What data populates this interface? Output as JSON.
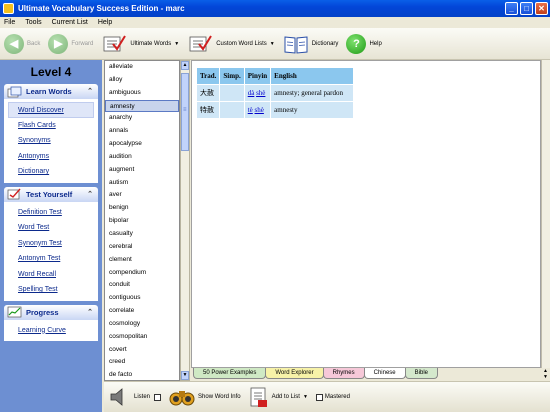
{
  "window": {
    "title": "Ultimate Vocabulary Success Edition - marc",
    "minimize": "_",
    "maximize": "□",
    "close": "✕"
  },
  "menu": [
    "File",
    "Tools",
    "Current List",
    "Help"
  ],
  "toolbar": {
    "back": "Back",
    "forward": "Forward",
    "ultimate_words": "Ultimate Words",
    "custom_word_lists": "Custom Word Lists",
    "dictionary": "Dictionary",
    "help": "Help",
    "help_glyph": "?"
  },
  "sidebar": {
    "level": "Level 4",
    "learn_words": {
      "title": "Learn Words",
      "items": [
        "Word Discover",
        "Flash Cards",
        "Synonyms",
        "Antonyms",
        "Dictionary"
      ]
    },
    "test_yourself": {
      "title": "Test Yourself",
      "items": [
        "Definition Test",
        "Word Test",
        "Synonym Test",
        "Antonym Test",
        "Word Recall",
        "Spelling Test"
      ]
    },
    "progress": {
      "title": "Progress",
      "items": [
        "Learning Curve"
      ]
    }
  },
  "word_list": [
    "alleviate",
    "alloy",
    "ambiguous",
    "amnesty",
    "anarchy",
    "annals",
    "apocalypse",
    "audition",
    "augment",
    "autism",
    "aver",
    "benign",
    "bipolar",
    "casualty",
    "cerebral",
    "clement",
    "compendium",
    "conduit",
    "contiguous",
    "correlate",
    "cosmology",
    "cosmopolitan",
    "covert",
    "creed",
    "de facto"
  ],
  "selected_word": "amnesty",
  "glossary": {
    "headers": [
      "Trad.",
      "Simp.",
      "Pinyin",
      "English"
    ],
    "rows": [
      {
        "trad": "大赦",
        "simp": "",
        "pinyin": [
          "dà",
          "shè"
        ],
        "english": "amnesty; general pardon"
      },
      {
        "trad": "特赦",
        "simp": "",
        "pinyin": [
          "tè",
          "shè"
        ],
        "english": "amnesty"
      }
    ]
  },
  "tabs": [
    {
      "label": "50 Power Examples",
      "color": "#cfe9c4"
    },
    {
      "label": "Word Explorer",
      "color": "#f7f2a8"
    },
    {
      "label": "Rhymes",
      "color": "#f6c8d8"
    },
    {
      "label": "Chinese",
      "color": "#ffffff"
    },
    {
      "label": "Bible",
      "color": "#d4e8cc"
    }
  ],
  "bottom": {
    "listen": "Listen",
    "show_word_info": "Show Word Info",
    "add_to_list": "Add to List",
    "mastered": "Mastered"
  }
}
